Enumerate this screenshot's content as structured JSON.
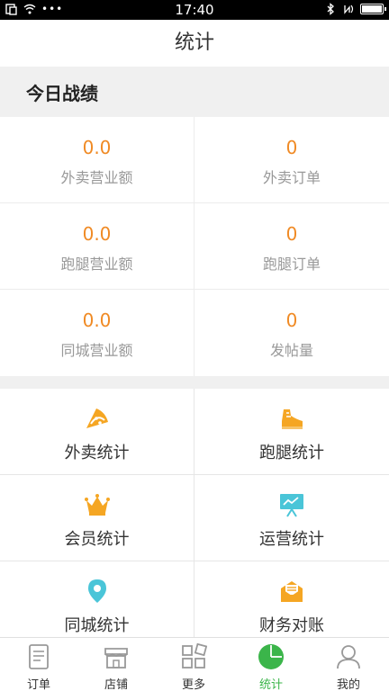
{
  "status_bar": {
    "time": "17:40"
  },
  "title": "统计",
  "today_section": {
    "heading": "今日战绩",
    "stats": [
      {
        "value": "0.0",
        "label": "外卖营业额"
      },
      {
        "value": "0",
        "label": "外卖订单"
      },
      {
        "value": "0.0",
        "label": "跑腿营业额"
      },
      {
        "value": "0",
        "label": "跑腿订单"
      },
      {
        "value": "0.0",
        "label": "同城营业额"
      },
      {
        "value": "0",
        "label": "发帖量"
      }
    ]
  },
  "menu": [
    {
      "label": "外卖统计",
      "icon": "pizza-icon",
      "color": "#f5a623"
    },
    {
      "label": "跑腿统计",
      "icon": "running-shoe-icon",
      "color": "#f5a623"
    },
    {
      "label": "会员统计",
      "icon": "crown-icon",
      "color": "#f5a623"
    },
    {
      "label": "运营统计",
      "icon": "presentation-chart-icon",
      "color": "#4ac5d8"
    },
    {
      "label": "同城统计",
      "icon": "location-pin-icon",
      "color": "#4ac5d8"
    },
    {
      "label": "财务对账",
      "icon": "envelope-list-icon",
      "color": "#f5a623"
    }
  ],
  "tabbar": [
    {
      "label": "订单",
      "icon": "order-icon",
      "active": false
    },
    {
      "label": "店铺",
      "icon": "store-icon",
      "active": false
    },
    {
      "label": "更多",
      "icon": "more-grid-icon",
      "active": false
    },
    {
      "label": "统计",
      "icon": "pie-chart-icon",
      "active": true
    },
    {
      "label": "我的",
      "icon": "profile-icon",
      "active": false
    }
  ],
  "colors": {
    "accent": "#f08a24",
    "active_tab": "#3bb54a",
    "icon_orange": "#f5a623",
    "icon_teal": "#4ac5d8"
  }
}
